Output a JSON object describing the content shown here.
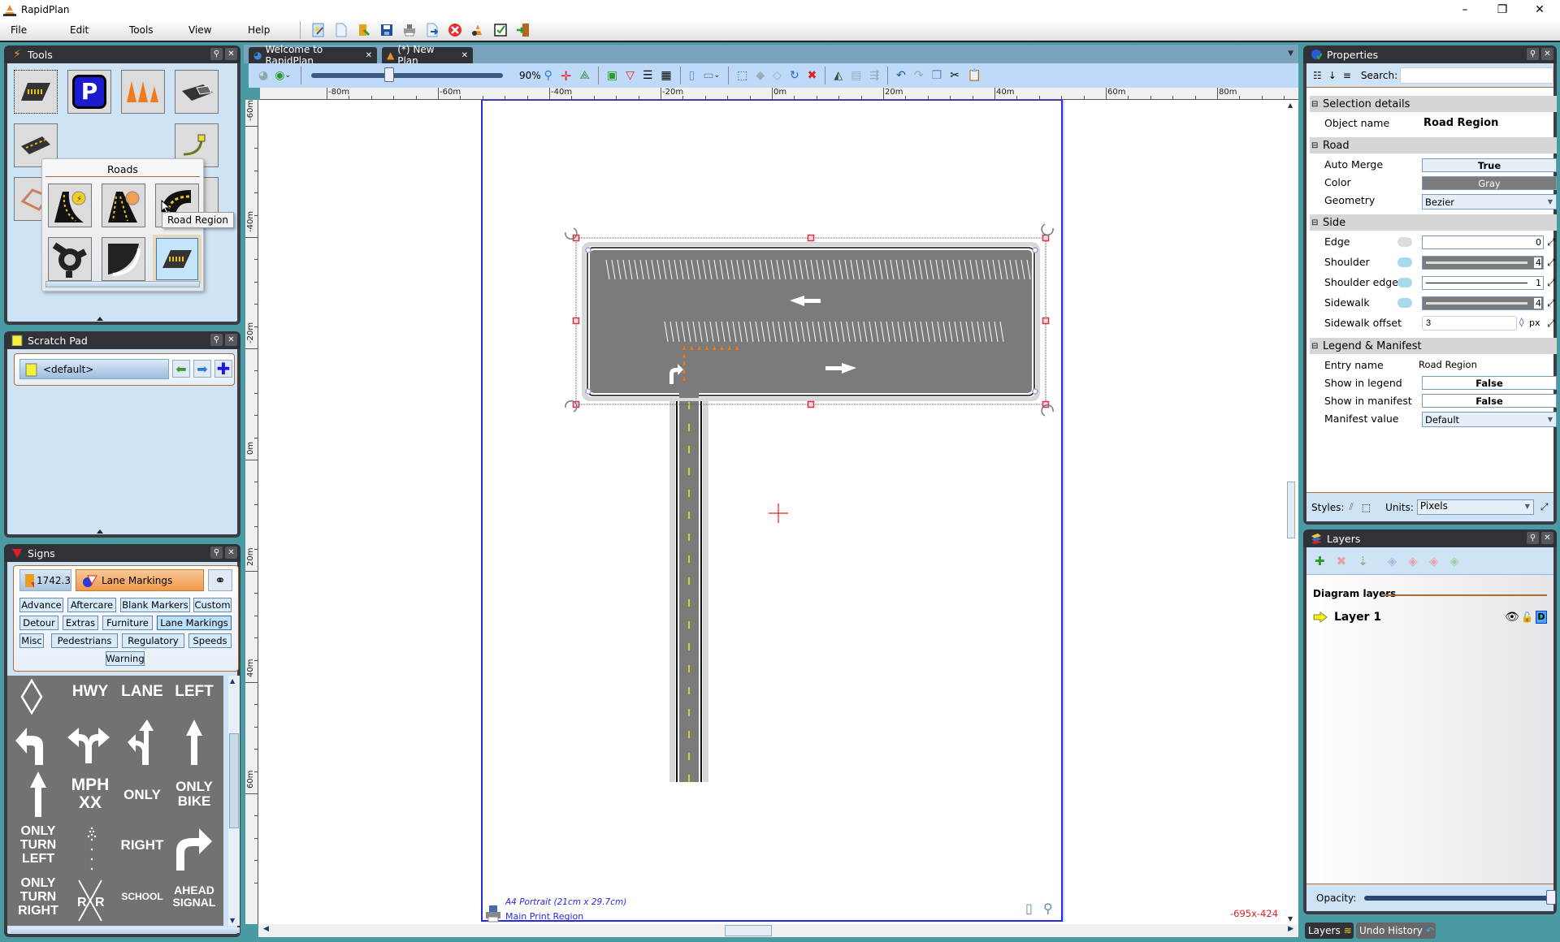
{
  "app": {
    "title": "RapidPlan"
  },
  "window_controls": {
    "minimize": "–",
    "restore": "❐",
    "close": "✕"
  },
  "menu": [
    "File",
    "Edit",
    "Tools",
    "View",
    "Help"
  ],
  "main_toolbar": [
    "new-wizard-icon",
    "new-document-icon",
    "open-folder-icon",
    "save-icon",
    "print-icon",
    "export-icon",
    "close-red-icon",
    "cone-settings-icon",
    "checkbox-icon",
    "exit-door-icon"
  ],
  "tools_panel": {
    "title": "Tools",
    "popup": {
      "title": "Roads",
      "items": [
        "Road Tool",
        "Lane Road Tool",
        "Curve Road Tool",
        "Roundabout Tool",
        "Corner Tool",
        "Road Region"
      ],
      "selected": "Road Region"
    },
    "tooltip": "Road Region"
  },
  "scratch_pad": {
    "title": "Scratch Pad",
    "value": "<default>"
  },
  "signs_panel": {
    "title": "Signs",
    "version": "1742.3",
    "current_category": "Lane Markings",
    "categories": [
      "Advance",
      "Aftercare",
      "Blank Markers",
      "Custom",
      "Detour",
      "Extras",
      "Furniture",
      "Lane Markings",
      "Misc",
      "Pedestrians",
      "Regulatory",
      "Speeds",
      "Warning"
    ],
    "selected_category": "Lane Markings",
    "signs": [
      {
        "type": "diamond",
        "text": ""
      },
      {
        "type": "text",
        "text": "HWY"
      },
      {
        "type": "text",
        "text": "LANE"
      },
      {
        "type": "text",
        "text": "LEFT"
      },
      {
        "type": "arrow",
        "text": "left-turn-arrow"
      },
      {
        "type": "arrow",
        "text": "split-arrow"
      },
      {
        "type": "arrow",
        "text": "straight-left-arrow"
      },
      {
        "type": "arrow",
        "text": "straight-arrow"
      },
      {
        "type": "arrow",
        "text": "straight-arrow-2"
      },
      {
        "type": "text",
        "text": "MPH\nXX"
      },
      {
        "type": "text",
        "text": "ONLY"
      },
      {
        "type": "text",
        "text": "ONLY\nBIKE"
      },
      {
        "type": "text",
        "text": "ONLY\nTURN\nLEFT"
      },
      {
        "type": "dots",
        "text": ""
      },
      {
        "type": "text",
        "text": "RIGHT"
      },
      {
        "type": "arrow",
        "text": "right-turn-arrow"
      },
      {
        "type": "text",
        "text": "ONLY\nTURN\nRIGHT"
      },
      {
        "type": "rxr",
        "text": "R  R"
      },
      {
        "type": "text",
        "text": "SCHOOL"
      },
      {
        "type": "text",
        "text": "AHEAD\nSIGNAL"
      }
    ]
  },
  "document_tabs": [
    {
      "label": "Welcome to RapidPlan",
      "active": false
    },
    {
      "label": "(*) New Plan",
      "active": true
    }
  ],
  "doc_toolbar": {
    "zoom": "90%",
    "zoom_fraction": 0.4
  },
  "rulers": {
    "horizontal": [
      "-80m",
      "-60m",
      "-40m",
      "-20m",
      "0m",
      "20m",
      "40m",
      "60m",
      "80m"
    ],
    "vertical": [
      "-60m",
      "-40m",
      "-20m",
      "0m",
      "20m",
      "40m",
      "60m"
    ]
  },
  "print_region": {
    "paper": "A4 Portrait (21cm x 29.7cm)",
    "name": "Main Print Region"
  },
  "cursor_coords": "-695x-424",
  "properties": {
    "title": "Properties",
    "search_label": "Search:",
    "search_value": "",
    "sections": {
      "selection": "Selection details",
      "road": "Road",
      "side": "Side",
      "legend": "Legend & Manifest"
    },
    "object_name_label": "Object name",
    "object_name": "Road Region",
    "auto_merge_label": "Auto Merge",
    "auto_merge": "True",
    "color_label": "Color",
    "color": "Gray",
    "geometry_label": "Geometry",
    "geometry": "Bezier",
    "edge_label": "Edge",
    "edge": "0",
    "shoulder_label": "Shoulder",
    "shoulder": "4",
    "shoulder_edge_label": "Shoulder edge",
    "shoulder_edge": "1",
    "sidewalk_label": "Sidewalk",
    "sidewalk": "4",
    "sidewalk_offset_label": "Sidewalk offset",
    "sidewalk_offset": "3",
    "sidewalk_offset_unit": "px",
    "entry_name_label": "Entry name",
    "entry_name": "Road Region",
    "show_legend_label": "Show in legend",
    "show_legend": "False",
    "show_manifest_label": "Show in manifest",
    "show_manifest": "False",
    "manifest_value_label": "Manifest value",
    "manifest_value": "Default",
    "styles_label": "Styles:",
    "units_label": "Units:",
    "units": "Pixels"
  },
  "layers": {
    "title": "Layers",
    "section": "Diagram layers",
    "items": [
      {
        "name": "Layer 1"
      }
    ],
    "opacity_label": "Opacity:",
    "opacity": 1.0
  },
  "bottom_tabs": [
    {
      "label": "Layers"
    },
    {
      "label": "Undo History"
    }
  ],
  "colors": {
    "road": "#7b7b7b",
    "accent_orange": "#f09a48",
    "selection_handle": "#e0304a",
    "coords_text": "#e02020"
  }
}
